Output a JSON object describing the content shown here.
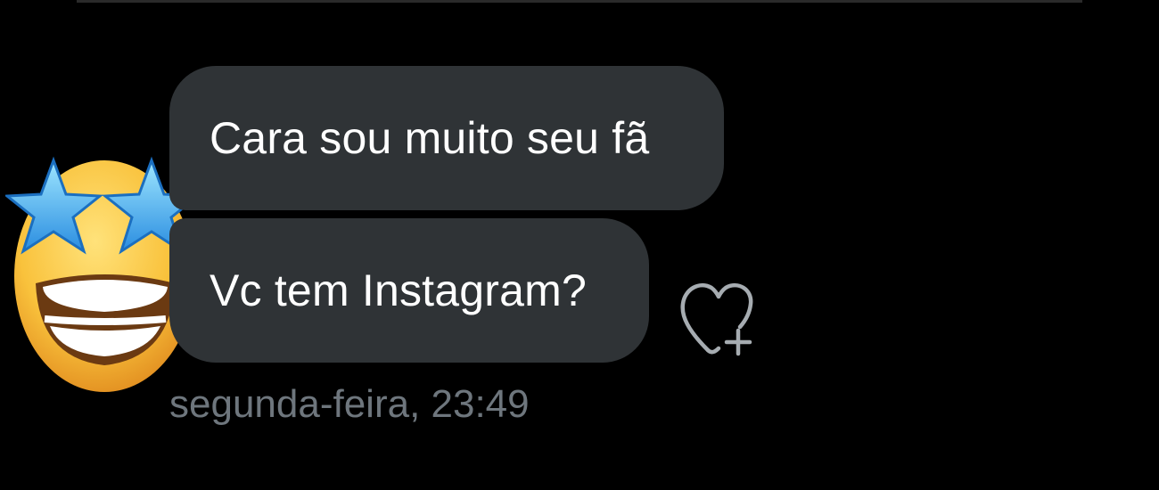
{
  "conversation": {
    "messages": [
      {
        "text": "Cara sou muito seu fã"
      },
      {
        "text": "Vc tem Instagram?"
      }
    ],
    "timestamp": "segunda-feira, 23:49"
  },
  "icons": {
    "react": "heart-plus-icon",
    "avatar": "star-struck-emoji"
  },
  "colors": {
    "background": "#000000",
    "bubble": "#2f3336",
    "message_text": "#ffffff",
    "timestamp_text": "#6e767d"
  }
}
